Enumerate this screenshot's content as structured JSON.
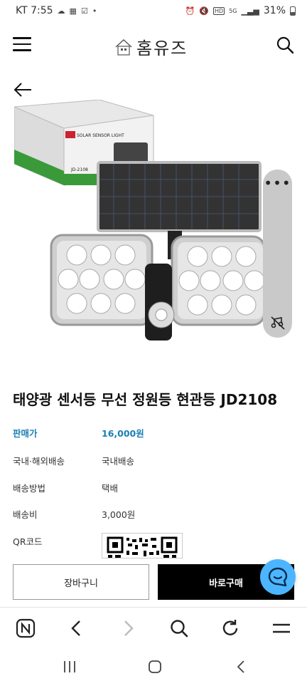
{
  "status_bar": {
    "carrier_time": "KT 7:55",
    "icons_left": [
      "cloud-icon",
      "calendar-icon",
      "check-icon",
      "dot-icon"
    ],
    "icons_right": [
      "alarm-icon",
      "mute-icon",
      "hd-icon",
      "5g-icon",
      "signal-icon"
    ],
    "battery": "31%"
  },
  "header": {
    "logo_text": "홈유즈",
    "logo_house_caption": "홈유즈"
  },
  "product": {
    "title": "태양광 센서등 무선 정원등 현관등 JD2108",
    "image_box_label": "SOLAR SENSOR LIGHT",
    "image_box_model": "JD-2108"
  },
  "info": {
    "price_label": "판매가",
    "price_value": "16,000원",
    "shipping_region_label": "국내·해외배송",
    "shipping_region_value": "국내배송",
    "shipping_method_label": "배송방법",
    "shipping_method_value": "택배",
    "shipping_fee_label": "배송비",
    "shipping_fee_value": "3,000원",
    "qr_label": "QR코드"
  },
  "actions": {
    "cart_label": "장바구니",
    "buy_label": "바로구매"
  },
  "colors": {
    "price_accent": "#1a7fb4",
    "buy_button_bg": "#000000",
    "chat_fab_bg": "#4bb6ff",
    "media_pill_bg": "#c9c9c9"
  }
}
